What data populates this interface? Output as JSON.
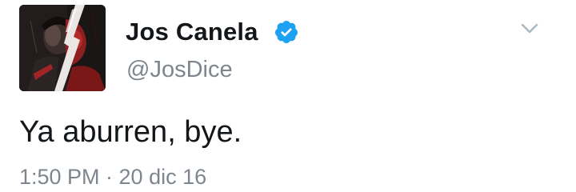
{
  "user": {
    "display_name": "Jos Canela",
    "username": "@JosDice",
    "verified_icon": "verified-badge-icon",
    "avatar": "profile-photo"
  },
  "tweet": {
    "text": "Ya aburren, bye.",
    "timestamp": "1:50 PM · 20 dic 16"
  },
  "menu": {
    "icon": "chevron-down-icon"
  },
  "colors": {
    "name": "#14171a",
    "secondary": "#7d868e",
    "verified": "#1da1f2",
    "caret": "#aab8c2"
  }
}
